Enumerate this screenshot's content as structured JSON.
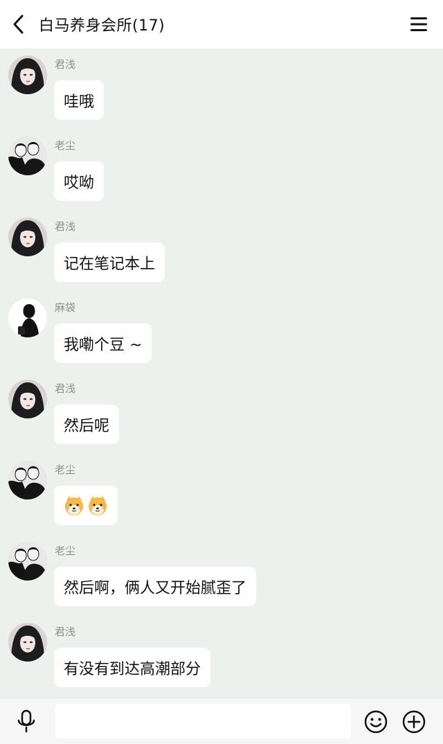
{
  "header": {
    "title": "白马养身会所(17)",
    "back_icon": "chevron-left-icon",
    "menu_icon": "hamburger-menu-icon"
  },
  "messages": [
    {
      "sender": "君浅",
      "text": "哇哦",
      "avatar": "avatar-junqian"
    },
    {
      "sender": "老尘",
      "text": "哎呦",
      "avatar": "avatar-laochen"
    },
    {
      "sender": "君浅",
      "text": "记在笔记本上",
      "avatar": "avatar-junqian"
    },
    {
      "sender": "麻袋",
      "text": "我嘞个豆 ~",
      "avatar": "avatar-madai"
    },
    {
      "sender": "君浅",
      "text": "然后呢",
      "avatar": "avatar-junqian"
    },
    {
      "sender": "老尘",
      "text": "",
      "avatar": "avatar-laochen",
      "emojis": [
        "shiba-dog-emoji",
        "shiba-dog-emoji"
      ]
    },
    {
      "sender": "老尘",
      "text": "然后啊，俩人又开始腻歪了",
      "avatar": "avatar-laochen"
    },
    {
      "sender": "君浅",
      "text": "有没有到达高潮部分",
      "avatar": "avatar-junqian"
    }
  ],
  "input_bar": {
    "mic_icon": "microphone-icon",
    "input_value": "",
    "emoji_icon": "smiley-icon",
    "plus_icon": "plus-circle-icon"
  },
  "colors": {
    "background": "#edf1ed",
    "header": "#ffffff",
    "bubble": "#ffffff",
    "sender_name": "#8f8f8f"
  }
}
